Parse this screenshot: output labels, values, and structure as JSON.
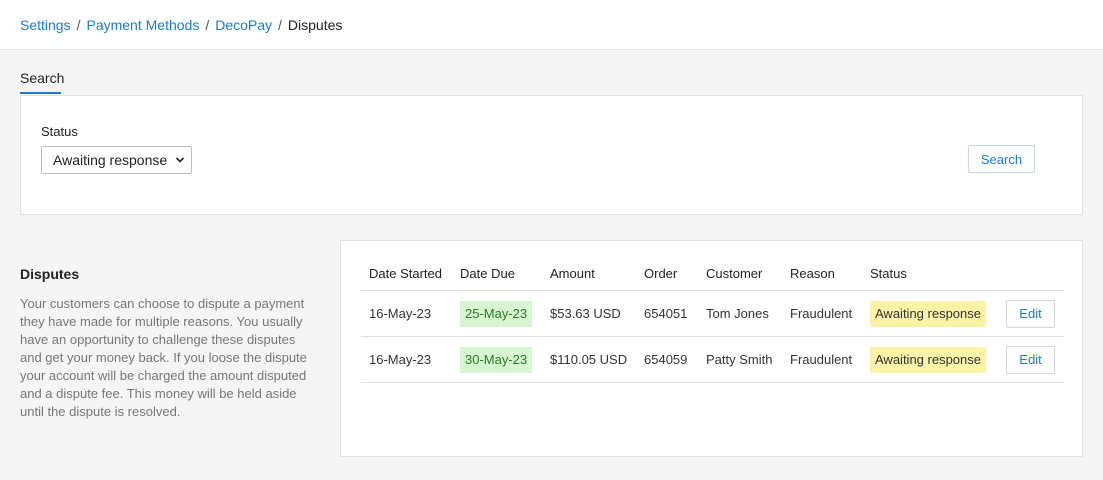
{
  "breadcrumb": {
    "items": [
      "Settings",
      "Payment Methods",
      "DecoPay"
    ],
    "separator": "/",
    "current": "Disputes"
  },
  "tabs": [
    {
      "label": "Search",
      "active": true
    }
  ],
  "search_form": {
    "status_label": "Status",
    "status_selected": "Awaiting response",
    "search_button": "Search"
  },
  "section": {
    "title": "Disputes",
    "description": "Your customers can choose to dispute a payment they have made for multiple reasons. You usually have an opportunity to challenge these disputes and get your money back. If you loose the dispute your account will be charged the amount disputed and a dispute fee. This money will be held aside until the dispute is resolved."
  },
  "table": {
    "columns": [
      "Date Started",
      "Date Due",
      "Amount",
      "Order",
      "Customer",
      "Reason",
      "Status"
    ],
    "rows": [
      {
        "date_started": "16-May-23",
        "date_due": "25-May-23",
        "amount": "$53.63 USD",
        "order": "654051",
        "customer": "Tom Jones",
        "reason": "Fraudulent",
        "status": "Awaiting response",
        "action": "Edit"
      },
      {
        "date_started": "16-May-23",
        "date_due": "30-May-23",
        "amount": "$110.05 USD",
        "order": "654059",
        "customer": "Patty Smith",
        "reason": "Fraudulent",
        "status": "Awaiting response",
        "action": "Edit"
      }
    ]
  },
  "colors": {
    "link": "#1a7ad4",
    "due_badge_bg": "#d6f5d0",
    "due_badge_text": "#2a7a22",
    "status_badge_bg": "#fbf3a6",
    "page_bg": "#f5f5f6"
  },
  "icons": {
    "select_chevron": "chevron-down-icon"
  }
}
